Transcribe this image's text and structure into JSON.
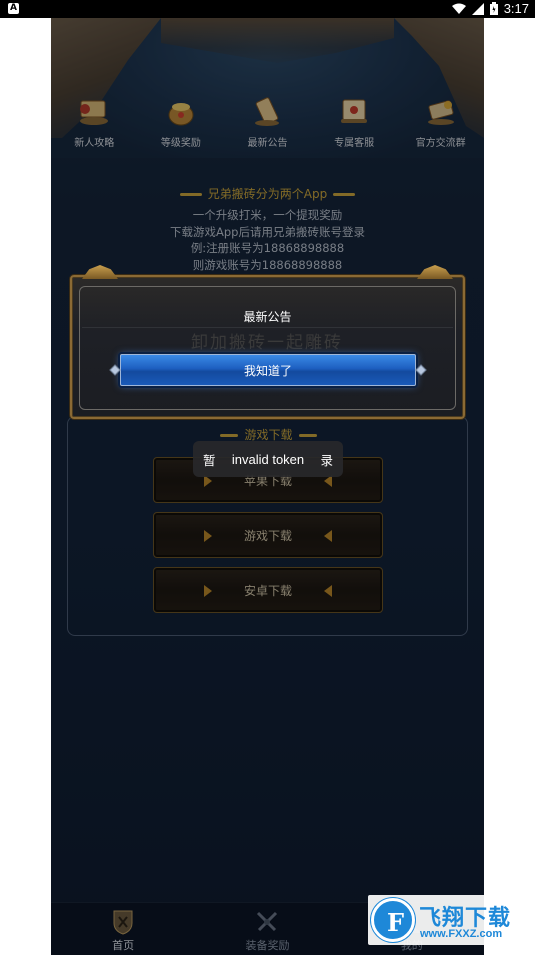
{
  "status_bar": {
    "left_badge": "A",
    "time": "3:17"
  },
  "nav": {
    "items": [
      {
        "label": "新人攻略",
        "icon": "guide-scroll-icon"
      },
      {
        "label": "等级奖励",
        "icon": "reward-pot-icon"
      },
      {
        "label": "最新公告",
        "icon": "announcement-scroll-icon"
      },
      {
        "label": "专属客服",
        "icon": "service-scroll-icon"
      },
      {
        "label": "官方交流群",
        "icon": "group-scroll-icon"
      }
    ]
  },
  "notice": {
    "title": "兄弟搬砖分为两个App",
    "lines": [
      "一个升级打米，一个提现奖励",
      "下载游戏App后请用兄弟搬砖账号登录",
      "例:注册账号为18868898888",
      "则游戏账号为18868898888"
    ]
  },
  "downloads": {
    "title": "游戏下载",
    "buttons": [
      "苹果下载",
      "游戏下载",
      "安卓下载"
    ]
  },
  "dialog": {
    "title": "最新公告",
    "ghost_text": "卸加搬砖一起雕砖",
    "confirm_label": "我知道了"
  },
  "toast": {
    "left": "暂",
    "message": "invalid token",
    "right": "录"
  },
  "tabbar": {
    "tabs": [
      {
        "label": "首页",
        "icon": "shield-home-icon",
        "active": true
      },
      {
        "label": "装备奖励",
        "icon": "crossed-swords-icon",
        "active": false
      },
      {
        "label": "我的",
        "icon": "profile-icon",
        "active": false
      }
    ]
  },
  "watermark": {
    "logo_letter": "F",
    "brand": "飞翔下载",
    "url": "www.FXXZ.com"
  },
  "colors": {
    "accent_gold": "#c8a43c",
    "confirm_blue": "#1d5fc0",
    "watermark_blue": "#1e88d8"
  }
}
